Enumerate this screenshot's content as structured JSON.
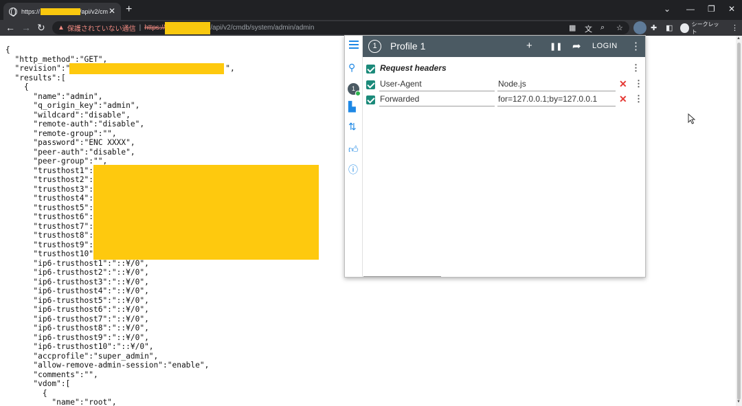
{
  "browser": {
    "tab_title": "https://",
    "tab_title_suffix": "/api/v2/cm",
    "new_tab_symbol": "+",
    "window_controls": {
      "dropdown": "⌄",
      "minimize": "—",
      "restore": "❐",
      "close": "✕"
    },
    "address": {
      "warning": "▲",
      "not_secure_label": "保護されていない通信",
      "separator": "|",
      "scheme": "https://",
      "path": "/api/v2/cmdb/system/admin/admin"
    },
    "incognito_label": "シークレット"
  },
  "json_text": {
    "l01": "{",
    "l02": "  \"http_method\":\"GET\",",
    "l03": "  \"revision\":\"",
    "l03_end": "\",",
    "l04": "  \"results\":[",
    "l05": "    {",
    "l06": "      \"name\":\"admin\",",
    "l07": "      \"q_origin_key\":\"admin\",",
    "l08": "      \"wildcard\":\"disable\",",
    "l09": "      \"remote-auth\":\"disable\",",
    "l10": "      \"remote-group\":\"\",",
    "l11": "      \"password\":\"ENC XXXX\",",
    "l12": "      \"peer-auth\":\"disable\",",
    "l13": "      \"peer-group\":\"\",",
    "l14": "      \"trusthost1\":",
    "l15": "      \"trusthost2\":",
    "l16": "      \"trusthost3\":",
    "l17": "      \"trusthost4\":",
    "l18": "      \"trusthost5\":",
    "l19": "      \"trusthost6\":",
    "l20": "      \"trusthost7\":",
    "l21": "      \"trusthost8\":",
    "l22": "      \"trusthost9\":",
    "l23": "      \"trusthost10\"",
    "l24": "      \"ip6-trusthost1\":\"::¥/0\",",
    "l25": "      \"ip6-trusthost2\":\"::¥/0\",",
    "l26": "      \"ip6-trusthost3\":\"::¥/0\",",
    "l27": "      \"ip6-trusthost4\":\"::¥/0\",",
    "l28": "      \"ip6-trusthost5\":\"::¥/0\",",
    "l29": "      \"ip6-trusthost6\":\"::¥/0\",",
    "l30": "      \"ip6-trusthost7\":\"::¥/0\",",
    "l31": "      \"ip6-trusthost8\":\"::¥/0\",",
    "l32": "      \"ip6-trusthost9\":\"::¥/0\",",
    "l33": "      \"ip6-trusthost10\":\"::¥/0\",",
    "l34": "      \"accprofile\":\"super_admin\",",
    "l35": "      \"allow-remove-admin-session\":\"enable\",",
    "l36": "      \"comments\":\"\",",
    "l37": "      \"vdom\":[",
    "l38": "        {",
    "l39": "          \"name\":\"root\","
  },
  "popup": {
    "profile_number": "1",
    "profile_name": "Profile 1",
    "add_symbol": "+",
    "pause_symbol": "❚❚",
    "share_symbol": "➦",
    "login_label": "LOGIN",
    "menu_symbol": "⋮",
    "side_badge": "1",
    "section_title": "Request headers",
    "headers": [
      {
        "name": "User-Agent",
        "value": "Node.js"
      },
      {
        "name": "Forwarded",
        "value": "for=127.0.0.1;by=127.0.0.1"
      }
    ],
    "delete_symbol": "✕"
  },
  "colors": {
    "redaction": "#fec90e",
    "accent_blue": "#1e88e5",
    "checkbox": "#1b8a7a",
    "popup_header": "#4b5a63",
    "delete_red": "#e53935"
  }
}
